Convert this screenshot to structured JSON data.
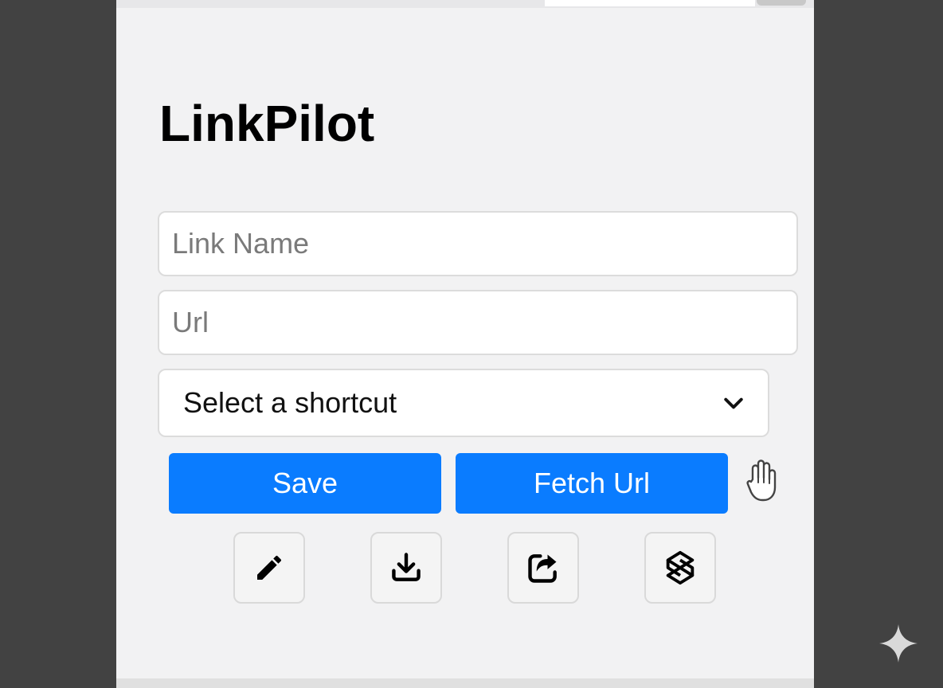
{
  "app": {
    "title": "LinkPilot"
  },
  "form": {
    "link_name": {
      "value": "",
      "placeholder": "Link Name"
    },
    "url": {
      "value": "",
      "placeholder": "Url"
    },
    "shortcut_select": {
      "selected": "Select a shortcut"
    }
  },
  "actions": {
    "save_label": "Save",
    "fetch_label": "Fetch Url"
  },
  "toolbar": {
    "icons": [
      "pencil-icon",
      "download-icon",
      "share-icon",
      "sync-icon"
    ]
  },
  "colors": {
    "accent": "#0a7cff",
    "panel_background": "#f2f2f3",
    "backdrop": "#424242"
  }
}
